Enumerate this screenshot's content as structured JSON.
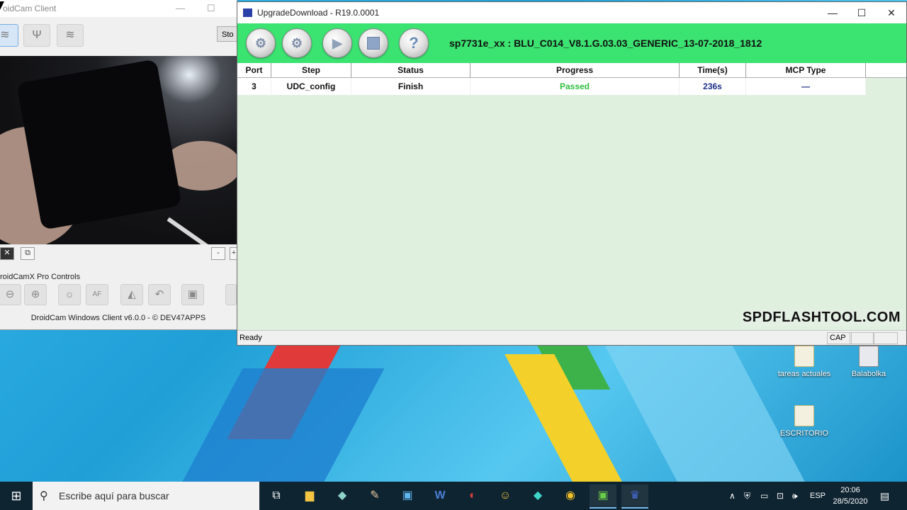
{
  "droidcam": {
    "title": "oidCam Client",
    "stop_label": "Sto",
    "controls_label": "roidCamX Pro Controls",
    "af_label": "AF",
    "footer": "DroidCam Windows Client v6.0.0 - © DEV47APPS",
    "minus": "-",
    "plus": "+"
  },
  "upgrade": {
    "title": "UpgradeDownload - R19.0.0001",
    "banner": "sp7731e_xx : BLU_C014_V8.1.G.03.03_GENERIC_13-07-2018_1812",
    "columns": [
      "Port",
      "Step",
      "Status",
      "Progress",
      "Time(s)",
      "MCP Type"
    ],
    "rows": [
      {
        "port": "3",
        "step": "UDC_config",
        "status": "Finish",
        "progress": "Passed",
        "time": "236s",
        "mcp": "—"
      }
    ],
    "status_text": "Ready",
    "cap": "CAP",
    "watermark": "SPDFLASHTOOL.COM"
  },
  "desktop": {
    "icons": [
      {
        "label": "tareas actuales"
      },
      {
        "label": "Balabolka"
      },
      {
        "label": "ESCRITORIO"
      }
    ]
  },
  "taskbar": {
    "search_placeholder": "Escribe aquí para buscar",
    "lang": "ESP",
    "time": "20:06",
    "date": "28/5/2020"
  },
  "colors": {
    "toolbar_green": "#3be371",
    "passed_green": "#2fc03f",
    "time_blue": "#1d2f8a",
    "list_bg": "#dff0df"
  }
}
